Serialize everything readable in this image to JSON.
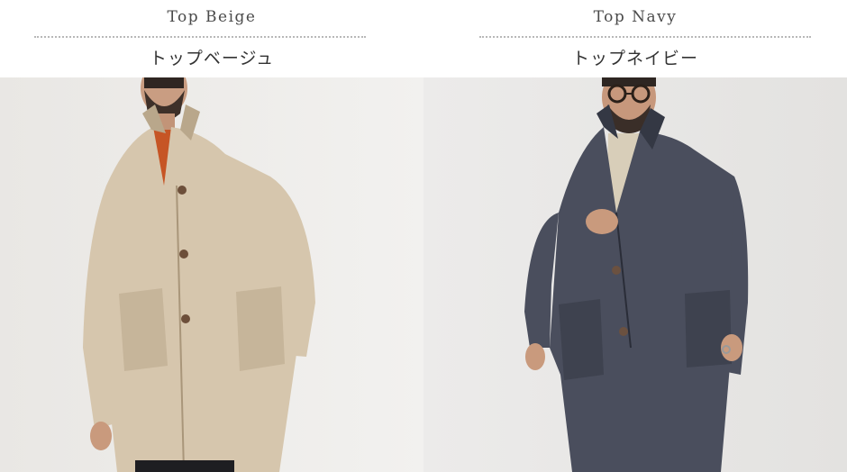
{
  "products": [
    {
      "label_en": "Top Beige",
      "label_jp": "トップベージュ",
      "coat_color": "#d6c6ad",
      "coat_shade": "#b9a78b"
    },
    {
      "label_en": "Top Navy",
      "label_jp": "トップネイビー",
      "coat_color": "#4a4e5d",
      "coat_shade": "#343844"
    }
  ]
}
